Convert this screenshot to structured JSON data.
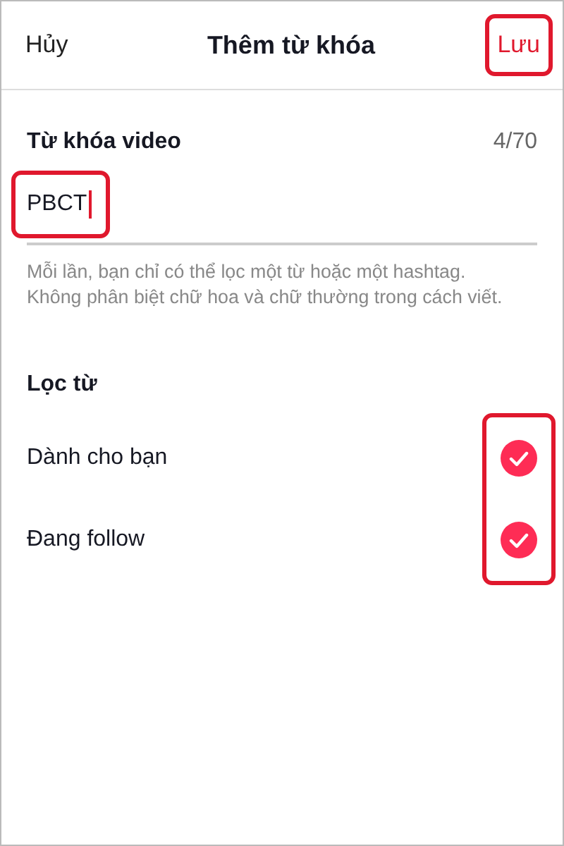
{
  "header": {
    "cancel": "Hủy",
    "title": "Thêm từ khóa",
    "save": {
      "label": "Lưu",
      "highlighted": true
    }
  },
  "keyword": {
    "label": "Từ khóa video",
    "counter": "4/70",
    "value": "PBCT",
    "highlighted": true,
    "hint": "Mỗi lần, bạn chỉ có thể lọc một từ hoặc một hashtag. Không phân biệt chữ hoa và chữ thường trong cách viết."
  },
  "filter": {
    "title": "Lọc từ",
    "highlighted": true,
    "options": [
      {
        "label": "Dành cho bạn",
        "checked": true
      },
      {
        "label": "Đang follow",
        "checked": true
      }
    ]
  }
}
